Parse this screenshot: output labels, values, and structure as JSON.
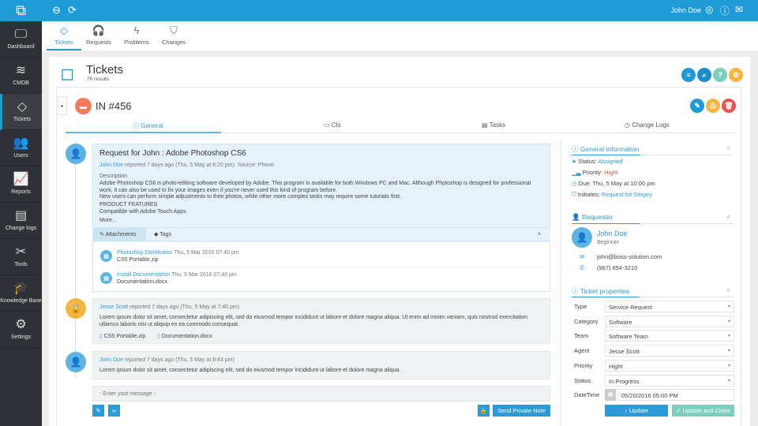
{
  "topbar": {
    "user_name": "John Doe"
  },
  "sidebar": {
    "items": [
      {
        "label": "Dashboard",
        "icon": "monitor-icon",
        "glyph": "🖵"
      },
      {
        "label": "CMDB",
        "icon": "database-icon",
        "glyph": "≋"
      },
      {
        "label": "Tickets",
        "icon": "tag-icon",
        "glyph": "◇"
      },
      {
        "label": "Users",
        "icon": "users-icon",
        "glyph": "👥"
      },
      {
        "label": "Reports",
        "icon": "chart-icon",
        "glyph": "📈"
      },
      {
        "label": "Change logs",
        "icon": "log-icon",
        "glyph": "▤"
      },
      {
        "label": "Tools",
        "icon": "tools-icon",
        "glyph": "✂"
      },
      {
        "label": "Knowledge Base",
        "icon": "graduation-icon",
        "glyph": "🎓"
      },
      {
        "label": "Settings",
        "icon": "gear-icon",
        "glyph": "⚙"
      }
    ]
  },
  "subnav": {
    "tabs": [
      {
        "label": "Tickets"
      },
      {
        "label": "Requests"
      },
      {
        "label": "Problems"
      },
      {
        "label": "Changes"
      }
    ]
  },
  "page": {
    "title": "Tickets",
    "results": "76 results"
  },
  "ticket": {
    "id": "IN #456",
    "tabs": [
      "General",
      "CIs",
      "Tasks",
      "Change Logs"
    ]
  },
  "request": {
    "title": "Request for John : Adobe Photoshop CS6",
    "author": "John Doe",
    "meta": "reported 7 days ago (Thu, 5 May at 6:20 pm). Source: Phone",
    "desc_label": "Description",
    "desc": "Adobe Photoshop CS6 is photo-editing software developed by Adobe. This program is available for both Windows PC and Mac. Although Photoshop is designed for professional work, it can also be used to fix your images even if you're never used this kind of program before.",
    "desc2": "New users can perform simple adjustments to their photos, while other more complex tasks may require some tutorials first.",
    "features_label": "PRODUCT FEATURES",
    "features": "Compatible with Adobe Touch Apps",
    "more": "More...",
    "tab_attachments": "Attachments",
    "tab_tags": "Tags",
    "attachments": [
      {
        "name": "Photoshop Distribution",
        "date": "Thu, 5 Mar 2016 07:40 pm",
        "file": "CS5 Portable.zip"
      },
      {
        "name": "Install Documentation",
        "date": "Thu, 5 Mar 2016 07:40 pm",
        "file": "Documentation.docx"
      }
    ]
  },
  "comments": [
    {
      "author": "Jesse Scott",
      "meta": "reported 7 days ago (Thu, 5 May at 7:40 pm)",
      "text": "Lorem ipsum dolor sit amet, consectetur adipiscing elit, sed do eiusmod tempor incididunt ut labore et dolore magna aliqua. Ut enim ad minim veniam, quis nostrud exercitation ullamco laboris nisi ut aliquip ex ea commodo consequat.",
      "files": [
        "CS5 Portable.zip",
        "Documentation.docx"
      ]
    },
    {
      "author": "John Doe",
      "meta": "reported 7 days ago (Thu, 5 May at 8:43 pm)",
      "text": "Lorem ipsum dolor sit amet, consectetur adipiscing elit, sed do eiusmod tempor incididunt ut labore et dolore magna aliqua."
    }
  ],
  "composer": {
    "placeholder": "- Enter yout message -",
    "send_label": "Send Private Note"
  },
  "general_info": {
    "title": "General information",
    "status_label": "Status:",
    "status": "Assigned",
    "priority_label": "Priority:",
    "priority": "Hight",
    "due": "Due: Thu, 5 May at 10:00 pm",
    "initiates_label": "Initiates:",
    "initiates": "Request fot Sergey"
  },
  "requester": {
    "title": "Requester",
    "name": "John Doe",
    "level": "Beginner",
    "email": "john@boss-solution.com",
    "phone": "(987) 654-3210"
  },
  "properties": {
    "title": "Ticket properties",
    "fields": [
      {
        "label": "Type",
        "value": "Service Request"
      },
      {
        "label": "Category",
        "value": "Software"
      },
      {
        "label": "Team",
        "value": "Software Team"
      },
      {
        "label": "Agent",
        "value": "Jesse Scott"
      },
      {
        "label": "Priority",
        "value": "Hight"
      },
      {
        "label": "Status",
        "value": "In Progress"
      }
    ],
    "datetime_label": "DateTime",
    "datetime": "05/20/2016  05:00 PM",
    "update_label": "Update",
    "update_close_label": "Update and Close"
  },
  "colors": {
    "brand": "#1e9bd7",
    "danger": "#f0504f",
    "success": "#7dcfbd",
    "warning": "#f6b53f"
  }
}
